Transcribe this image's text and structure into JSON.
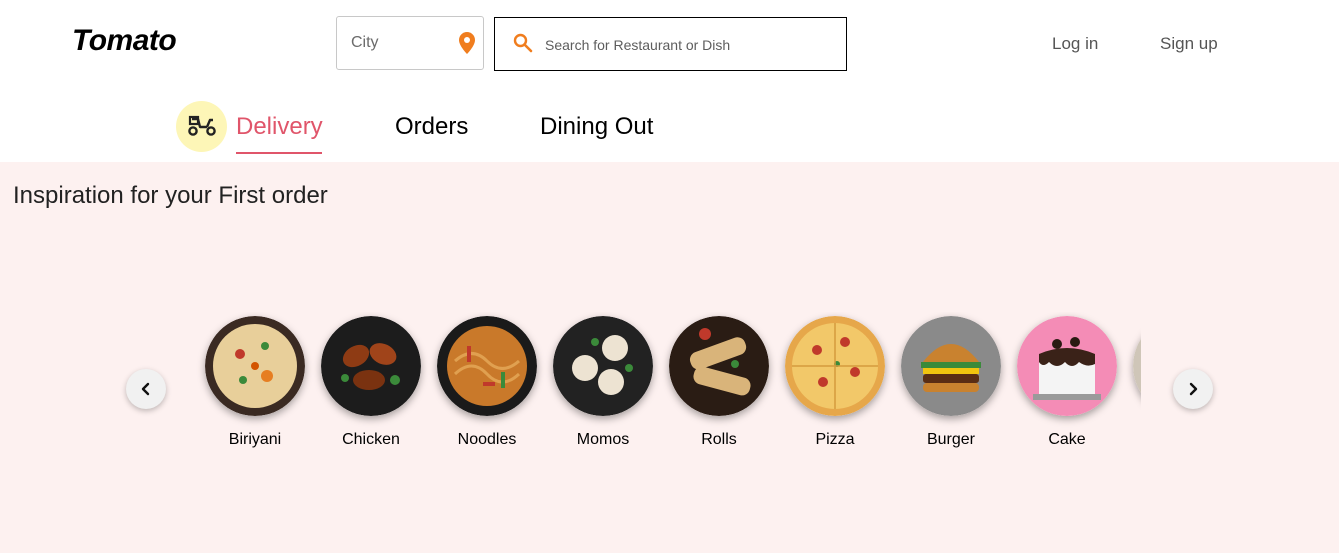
{
  "header": {
    "logo": "Tomato",
    "city_placeholder": "City",
    "search_placeholder": "Search for Restaurant or Dish",
    "login": "Log in",
    "signup": "Sign up"
  },
  "tabs": [
    {
      "label": "Delivery",
      "active": true
    },
    {
      "label": "Orders",
      "active": false
    },
    {
      "label": "Dining Out",
      "active": false
    }
  ],
  "section": {
    "title": "Inspiration for your First order",
    "items": [
      {
        "label": "Biriyani"
      },
      {
        "label": "Chicken"
      },
      {
        "label": "Noodles"
      },
      {
        "label": "Momos"
      },
      {
        "label": "Rolls"
      },
      {
        "label": "Pizza"
      },
      {
        "label": "Burger"
      },
      {
        "label": "Cake"
      }
    ]
  },
  "colors": {
    "accent": "#e0556a",
    "pin": "#f07d1e",
    "panel_bg": "#fdf1f0",
    "delivery_icon_bg": "#fdf6b7"
  }
}
